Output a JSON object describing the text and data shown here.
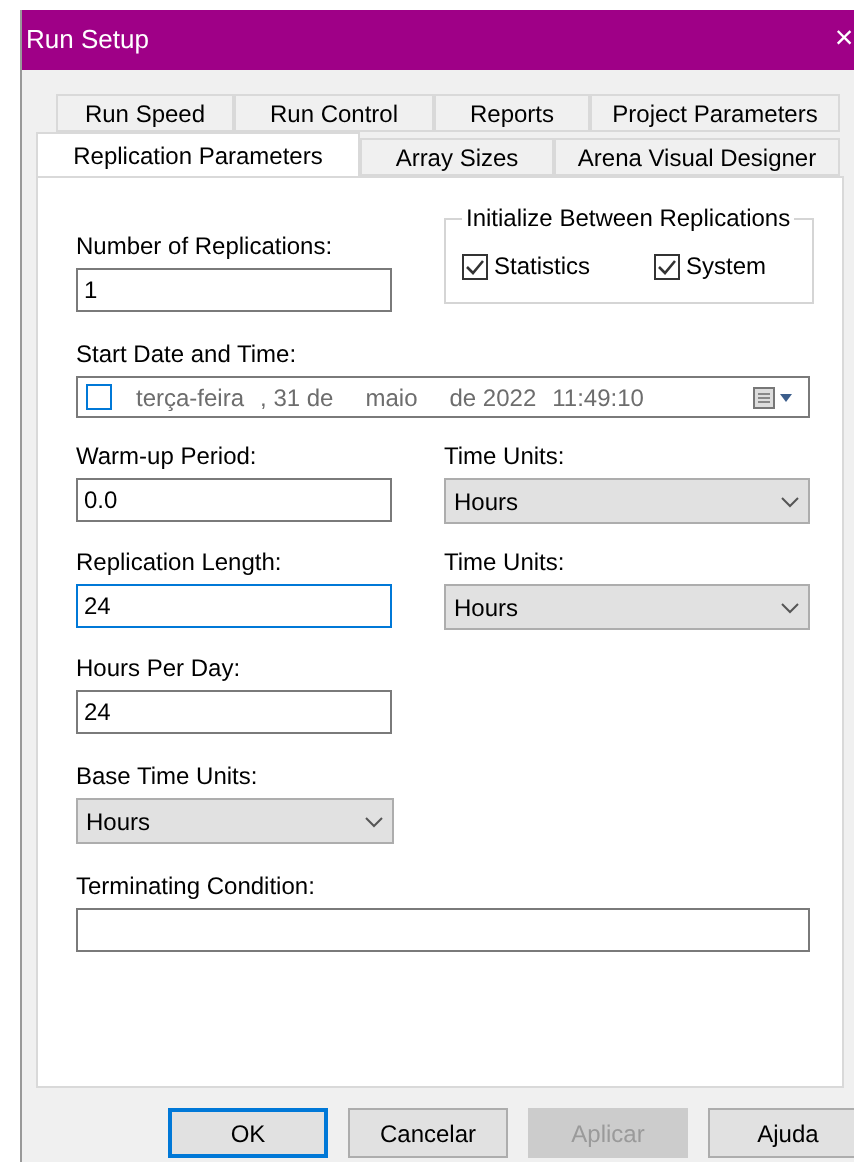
{
  "window": {
    "title": "Run Setup",
    "close": "×"
  },
  "tab_rows": [
    [
      {
        "label": "Run Speed",
        "selected": false
      },
      {
        "label": "Run Control",
        "selected": false
      },
      {
        "label": "Reports",
        "selected": false
      },
      {
        "label": "Project Parameters",
        "selected": false
      }
    ],
    [
      {
        "label": "Replication Parameters",
        "selected": true
      },
      {
        "label": "Array Sizes",
        "selected": false
      },
      {
        "label": "Arena Visual Designer",
        "selected": false
      }
    ]
  ],
  "replications": {
    "label": "Number of Replications:",
    "value": "1",
    "focused": false
  },
  "initialize": {
    "title": "Initialize Between Replications",
    "options": [
      {
        "label": "Statistics",
        "checked": true
      },
      {
        "label": "System",
        "checked": true
      }
    ]
  },
  "start_date": {
    "label": "Start Date and Time:",
    "checked": false,
    "parts": [
      "terça-feira",
      ", 31 de",
      "maio",
      "de 2022",
      "11:49:10"
    ]
  },
  "warm_up": {
    "label": "Warm-up Period:",
    "value": "0.0",
    "focused": false,
    "units_label": "Time Units:",
    "units": "Hours"
  },
  "replication_length": {
    "label": "Replication Length:",
    "value": "24",
    "focused": true,
    "units_label": "Time Units:",
    "units": "Hours"
  },
  "hours_per_day": {
    "label": "Hours Per Day:",
    "value": "24",
    "focused": false
  },
  "base_time_units": {
    "label": "Base Time Units:",
    "value": "Hours"
  },
  "terminating_condition": {
    "label": "Terminating Condition:",
    "focused": false
  },
  "buttons": [
    {
      "label": "OK",
      "default": true,
      "disabled": false
    },
    {
      "label": "Cancelar",
      "default": false,
      "disabled": false
    },
    {
      "label": "Aplicar",
      "default": false,
      "disabled": true
    },
    {
      "label": "Ajuda",
      "default": false,
      "disabled": false
    }
  ]
}
